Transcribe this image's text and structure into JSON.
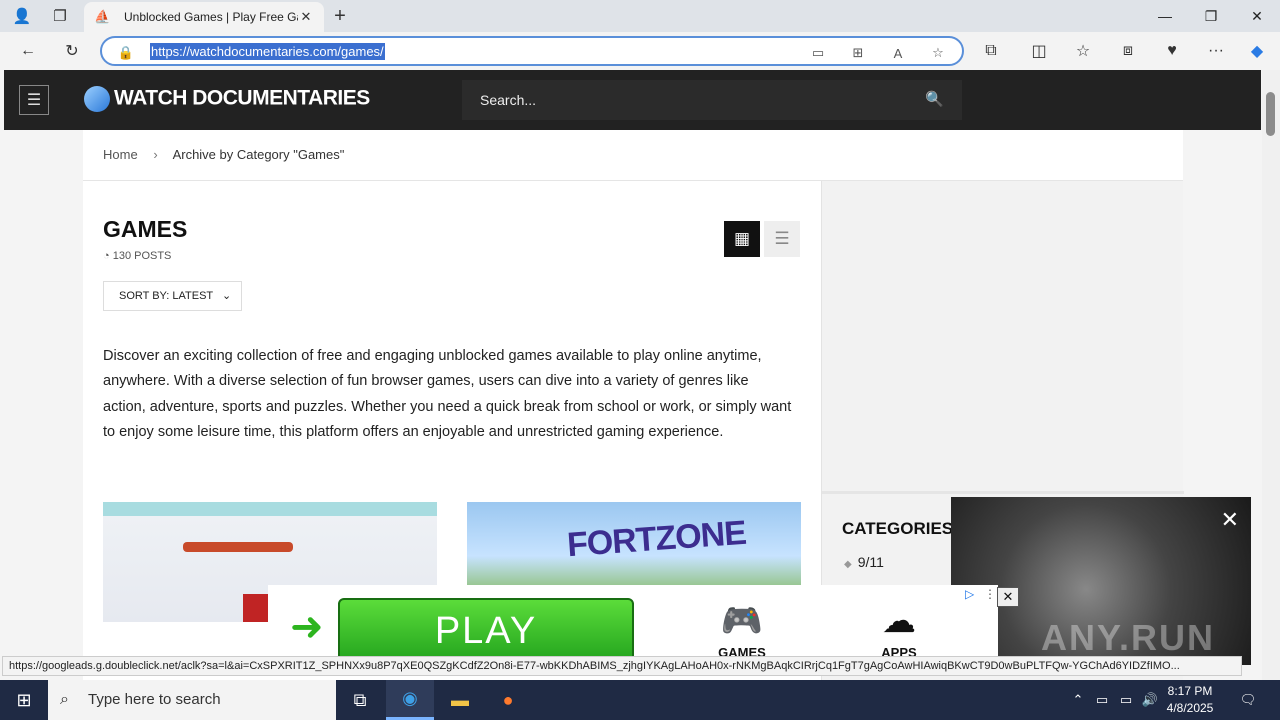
{
  "browser": {
    "tab_title": "Unblocked Games | Play Free Gar",
    "url": "https://watchdocumentaries.com/games/",
    "status_url": "https://googleads.g.doubleclick.net/aclk?sa=l&ai=CxSPXRIT1Z_SPHNXx9u8P7qXE0QSZgKCdfZ2On8i-E77-wbKKDhABIMS_zjhgIYKAgLAHoAH0x-rNKMgBAqkCIRrjCq1FgT7gAgCoAwHIAwiqBKwCT9D0wBuPLTFQw-YGChAd6YIDZfIMO..."
  },
  "site": {
    "logo_text": "WATCH DOCUMENTARIES",
    "search_placeholder": "Search..."
  },
  "breadcrumb": {
    "home": "Home",
    "sep": "›",
    "current": "Archive by Category \"Games\""
  },
  "main": {
    "title": "GAMES",
    "post_count": "130 POSTS",
    "sort_label": "SORT BY: LATEST",
    "description": "Discover an exciting collection of free and engaging unblocked games available to play online anytime, anywhere. With a diverse selection of fun browser games, users can dive into a variety of genres like action, adventure, sports and puzzles. Whether you need a quick break from school or work, or simply want to enjoy some leisure time, this platform offers an enjoyable and unrestricted gaming experience.",
    "card2_title": "FORTZONE"
  },
  "sidebar": {
    "categories_title": "CATEGORIES",
    "first_item": "9/11"
  },
  "ad": {
    "play_label": "PLAY",
    "games_label": "GAMES",
    "apps_label": "APPS",
    "watermark": "ANY.RUN"
  },
  "taskbar": {
    "search_placeholder": "Type here to search",
    "time": "8:17 PM",
    "date": "4/8/2025"
  },
  "icons": [
    "profile-icon",
    "tab-actions-icon",
    "edge-favicon",
    "close-tab-icon",
    "new-tab-icon",
    "minimize-icon",
    "restore-icon",
    "close-window-icon",
    "back-icon",
    "refresh-icon",
    "lock-icon",
    "cast-icon",
    "apps-icon",
    "read-aloud-icon",
    "favorite-star-icon",
    "extensions-icon",
    "split-screen-icon",
    "favorites-icon",
    "collections-icon",
    "performance-icon",
    "more-icon",
    "copilot-icon",
    "hamburger-icon",
    "search-icon",
    "rss-icon",
    "grid-view-icon",
    "list-view-icon",
    "chevron-down-icon",
    "windows-start-icon",
    "task-view-icon",
    "edge-taskbar-icon",
    "file-explorer-icon",
    "firefox-icon",
    "notifications-icon"
  ]
}
